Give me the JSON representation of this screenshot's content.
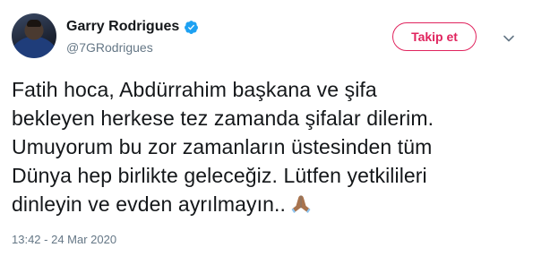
{
  "author": {
    "display_name": "Garry Rodrigues",
    "handle": "@7GRodrigues",
    "verified": true
  },
  "actions": {
    "follow_label": "Takip et"
  },
  "tweet": {
    "lines": [
      "Fatih hoca, Abdürrahim başkana ve şifa",
      "bekleyen herkese tez zamanda şifalar dilerim.",
      "Umuyorum bu zor zamanların üstesinden tüm",
      "Dünya hep birlikte geleceğiz. Lütfen yetkilileri",
      "dinleyin ve evden ayrılmayın.."
    ],
    "emoji": "folded-hands-emoji",
    "timestamp": "13:42 - 24 Mar 2020"
  },
  "colors": {
    "follow_accent": "#e0245e",
    "verified_blue": "#1da1f2",
    "secondary_text": "#657786"
  }
}
